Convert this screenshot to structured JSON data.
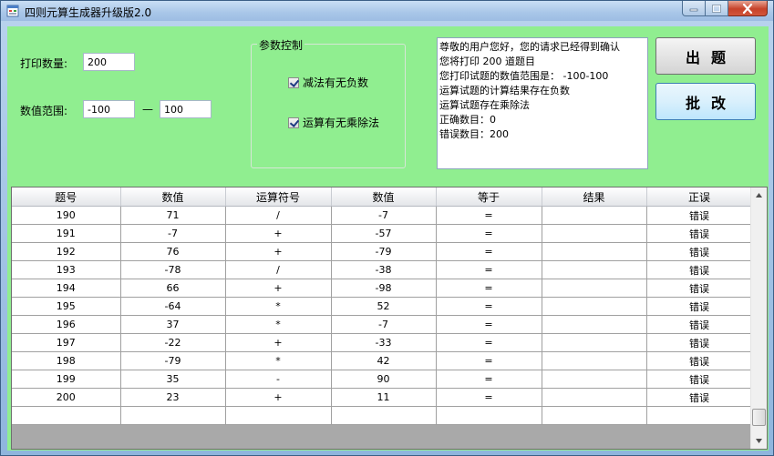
{
  "window": {
    "title": "四则元算生成器升级版2.0"
  },
  "form": {
    "print_count_label": "打印数量:",
    "print_count_value": "200",
    "range_label": "数值范围:",
    "range_min": "-100",
    "range_sep": "—",
    "range_max": "100"
  },
  "group": {
    "title": "参数控制",
    "options": [
      {
        "label": "减法有无负数",
        "checked": true
      },
      {
        "label": "运算有无乘除法",
        "checked": true
      }
    ]
  },
  "message": {
    "lines": [
      "尊敬的用户您好，您的请求已经得到确认",
      "您将打印 200 道题目",
      "您打印试题的数值范围是： -100-100",
      "运算试题的计算结果存在负数",
      "运算试题存在乘除法",
      "正确数目：0",
      "错误数目：200"
    ]
  },
  "buttons": {
    "generate": "出题",
    "grade": "批改"
  },
  "table": {
    "columns": [
      "题号",
      "数值",
      "运算符号",
      "数值",
      "等于",
      "结果",
      "正误"
    ],
    "rows": [
      [
        "190",
        "71",
        "/",
        "-7",
        "=",
        "",
        "错误"
      ],
      [
        "191",
        "-7",
        "+",
        "-57",
        "=",
        "",
        "错误"
      ],
      [
        "192",
        "76",
        "+",
        "-79",
        "=",
        "",
        "错误"
      ],
      [
        "193",
        "-78",
        "/",
        "-38",
        "=",
        "",
        "错误"
      ],
      [
        "194",
        "66",
        "+",
        "-98",
        "=",
        "",
        "错误"
      ],
      [
        "195",
        "-64",
        "*",
        "52",
        "=",
        "",
        "错误"
      ],
      [
        "196",
        "37",
        "*",
        "-7",
        "=",
        "",
        "错误"
      ],
      [
        "197",
        "-22",
        "+",
        "-33",
        "=",
        "",
        "错误"
      ],
      [
        "198",
        "-79",
        "*",
        "42",
        "=",
        "",
        "错误"
      ],
      [
        "199",
        "35",
        "-",
        "90",
        "=",
        "",
        "错误"
      ],
      [
        "200",
        "23",
        "+",
        "11",
        "=",
        "",
        "错误"
      ],
      [
        "",
        "",
        "",
        "",
        "",
        "",
        ""
      ]
    ]
  },
  "colors": {
    "client_bg": "#90ee90"
  }
}
